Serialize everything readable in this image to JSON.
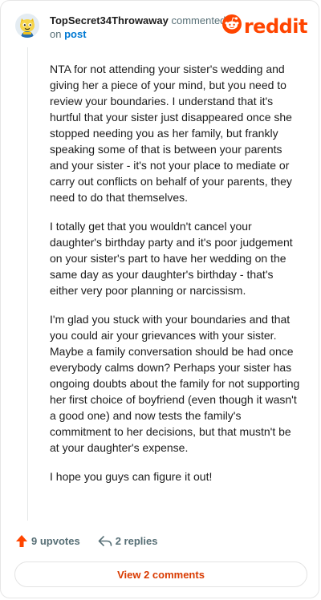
{
  "comment": {
    "author": "TopSecret34Throwaway",
    "action_text": " commented on ",
    "post_link": "post",
    "paragraphs": [
      "NTA for not attending your sister's wedding and giving her a piece of your mind, but you need to review your boundaries. I understand that it's hurtful that your sister just disappeared once she stopped needing you as her family, but frankly speaking some of that is between your parents and your sister - it's not your place to mediate or carry out conflicts on behalf of your parents, they need to do that themselves.",
      "I totally get that you wouldn't cancel your daughter's birthday party and it's poor judgement on your sister's part to have her wedding on the same day as your daughter's birthday - that's either very poor planning or narcissism.",
      "I'm glad you stuck with your boundaries and that you could air your grievances with your sister. Maybe a family conversation should be had once everybody calms down? Perhaps your sister has ongoing doubts about the family for not supporting her first choice of boyfriend (even though it wasn't a good one) and now tests the family's commitment to her decisions, but that mustn't be at your daughter's expense.",
      "I hope you guys can figure it out!"
    ]
  },
  "brand": {
    "name": "reddit",
    "color": "#ff4500"
  },
  "actions": {
    "upvotes": "9 upvotes",
    "replies": "2 replies"
  },
  "footer": {
    "view_comments": "View 2 comments"
  },
  "icons": {
    "avatar": "avatar-icon",
    "upvote": "upvote-arrow-icon",
    "reply": "reply-arrow-icon",
    "logo": "reddit-snoo-icon"
  },
  "colors": {
    "accent": "#ff4500",
    "link": "#0079d3",
    "muted": "#576f76",
    "button_text": "#d93a00"
  }
}
